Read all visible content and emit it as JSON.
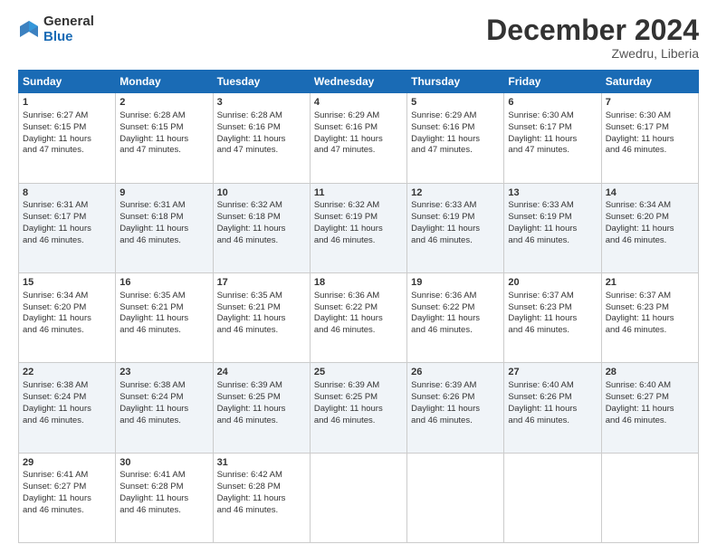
{
  "logo": {
    "general": "General",
    "blue": "Blue"
  },
  "header": {
    "month": "December 2024",
    "location": "Zwedru, Liberia"
  },
  "weekdays": [
    "Sunday",
    "Monday",
    "Tuesday",
    "Wednesday",
    "Thursday",
    "Friday",
    "Saturday"
  ],
  "weeks": [
    [
      {
        "day": "1",
        "sunrise": "6:27 AM",
        "sunset": "6:15 PM",
        "daylight": "11 hours and 47 minutes."
      },
      {
        "day": "2",
        "sunrise": "6:28 AM",
        "sunset": "6:15 PM",
        "daylight": "11 hours and 47 minutes."
      },
      {
        "day": "3",
        "sunrise": "6:28 AM",
        "sunset": "6:16 PM",
        "daylight": "11 hours and 47 minutes."
      },
      {
        "day": "4",
        "sunrise": "6:29 AM",
        "sunset": "6:16 PM",
        "daylight": "11 hours and 47 minutes."
      },
      {
        "day": "5",
        "sunrise": "6:29 AM",
        "sunset": "6:16 PM",
        "daylight": "11 hours and 47 minutes."
      },
      {
        "day": "6",
        "sunrise": "6:30 AM",
        "sunset": "6:17 PM",
        "daylight": "11 hours and 47 minutes."
      },
      {
        "day": "7",
        "sunrise": "6:30 AM",
        "sunset": "6:17 PM",
        "daylight": "11 hours and 46 minutes."
      }
    ],
    [
      {
        "day": "8",
        "sunrise": "6:31 AM",
        "sunset": "6:17 PM",
        "daylight": "11 hours and 46 minutes."
      },
      {
        "day": "9",
        "sunrise": "6:31 AM",
        "sunset": "6:18 PM",
        "daylight": "11 hours and 46 minutes."
      },
      {
        "day": "10",
        "sunrise": "6:32 AM",
        "sunset": "6:18 PM",
        "daylight": "11 hours and 46 minutes."
      },
      {
        "day": "11",
        "sunrise": "6:32 AM",
        "sunset": "6:19 PM",
        "daylight": "11 hours and 46 minutes."
      },
      {
        "day": "12",
        "sunrise": "6:33 AM",
        "sunset": "6:19 PM",
        "daylight": "11 hours and 46 minutes."
      },
      {
        "day": "13",
        "sunrise": "6:33 AM",
        "sunset": "6:19 PM",
        "daylight": "11 hours and 46 minutes."
      },
      {
        "day": "14",
        "sunrise": "6:34 AM",
        "sunset": "6:20 PM",
        "daylight": "11 hours and 46 minutes."
      }
    ],
    [
      {
        "day": "15",
        "sunrise": "6:34 AM",
        "sunset": "6:20 PM",
        "daylight": "11 hours and 46 minutes."
      },
      {
        "day": "16",
        "sunrise": "6:35 AM",
        "sunset": "6:21 PM",
        "daylight": "11 hours and 46 minutes."
      },
      {
        "day": "17",
        "sunrise": "6:35 AM",
        "sunset": "6:21 PM",
        "daylight": "11 hours and 46 minutes."
      },
      {
        "day": "18",
        "sunrise": "6:36 AM",
        "sunset": "6:22 PM",
        "daylight": "11 hours and 46 minutes."
      },
      {
        "day": "19",
        "sunrise": "6:36 AM",
        "sunset": "6:22 PM",
        "daylight": "11 hours and 46 minutes."
      },
      {
        "day": "20",
        "sunrise": "6:37 AM",
        "sunset": "6:23 PM",
        "daylight": "11 hours and 46 minutes."
      },
      {
        "day": "21",
        "sunrise": "6:37 AM",
        "sunset": "6:23 PM",
        "daylight": "11 hours and 46 minutes."
      }
    ],
    [
      {
        "day": "22",
        "sunrise": "6:38 AM",
        "sunset": "6:24 PM",
        "daylight": "11 hours and 46 minutes."
      },
      {
        "day": "23",
        "sunrise": "6:38 AM",
        "sunset": "6:24 PM",
        "daylight": "11 hours and 46 minutes."
      },
      {
        "day": "24",
        "sunrise": "6:39 AM",
        "sunset": "6:25 PM",
        "daylight": "11 hours and 46 minutes."
      },
      {
        "day": "25",
        "sunrise": "6:39 AM",
        "sunset": "6:25 PM",
        "daylight": "11 hours and 46 minutes."
      },
      {
        "day": "26",
        "sunrise": "6:39 AM",
        "sunset": "6:26 PM",
        "daylight": "11 hours and 46 minutes."
      },
      {
        "day": "27",
        "sunrise": "6:40 AM",
        "sunset": "6:26 PM",
        "daylight": "11 hours and 46 minutes."
      },
      {
        "day": "28",
        "sunrise": "6:40 AM",
        "sunset": "6:27 PM",
        "daylight": "11 hours and 46 minutes."
      }
    ],
    [
      {
        "day": "29",
        "sunrise": "6:41 AM",
        "sunset": "6:27 PM",
        "daylight": "11 hours and 46 minutes."
      },
      {
        "day": "30",
        "sunrise": "6:41 AM",
        "sunset": "6:28 PM",
        "daylight": "11 hours and 46 minutes."
      },
      {
        "day": "31",
        "sunrise": "6:42 AM",
        "sunset": "6:28 PM",
        "daylight": "11 hours and 46 minutes."
      },
      null,
      null,
      null,
      null
    ]
  ],
  "labels": {
    "sunrise": "Sunrise:",
    "sunset": "Sunset:",
    "daylight": "Daylight:"
  }
}
